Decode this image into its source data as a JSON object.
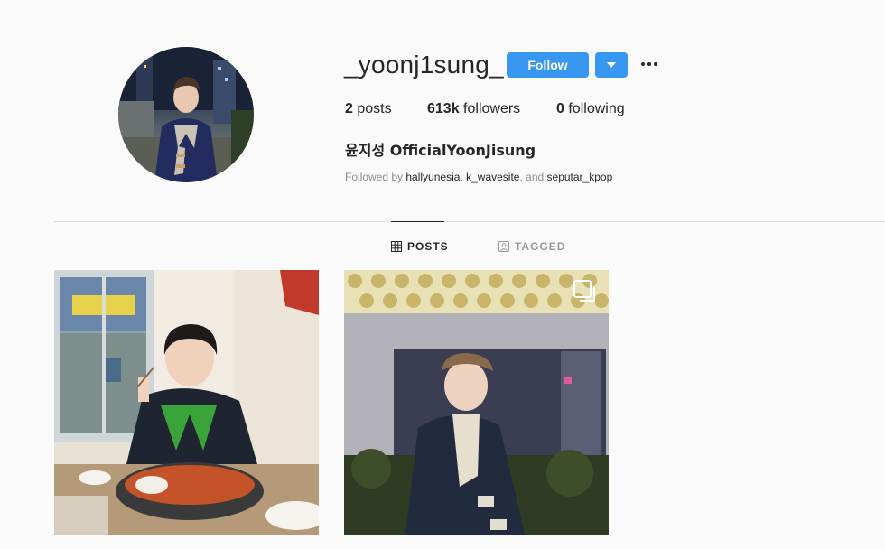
{
  "profile": {
    "username": "_yoonj1sung_",
    "full_name": "윤지성 OfficialYoonJisung",
    "avatar_icon": "profile-photo"
  },
  "actions": {
    "follow_label": "Follow",
    "dropdown_icon": "caret-down-icon",
    "more_icon": "ellipsis-icon"
  },
  "stats": {
    "posts_count": "2",
    "posts_label": "posts",
    "followers_count": "613k",
    "followers_label": "followers",
    "following_count": "0",
    "following_label": "following"
  },
  "followed_by": {
    "prefix": "Followed by",
    "accounts": [
      "hallyunesia",
      "k_wavesite",
      "seputar_kpop"
    ],
    "sep1": ",",
    "sep2": ", and"
  },
  "tabs": [
    {
      "label": "POSTS",
      "icon": "grid-icon",
      "active": true
    },
    {
      "label": "TAGGED",
      "icon": "tag-icon",
      "active": false
    }
  ],
  "posts": [
    {
      "subject": "man eating stir-fried food at restaurant table"
    },
    {
      "subject": "man in beret and duffle coat outdoors at night",
      "multi": true
    }
  ],
  "colors": {
    "accent": "#3897f0",
    "text": "#262626",
    "muted": "#8e8e8e",
    "background": "#fafafa",
    "divider": "#dbdbdb"
  }
}
